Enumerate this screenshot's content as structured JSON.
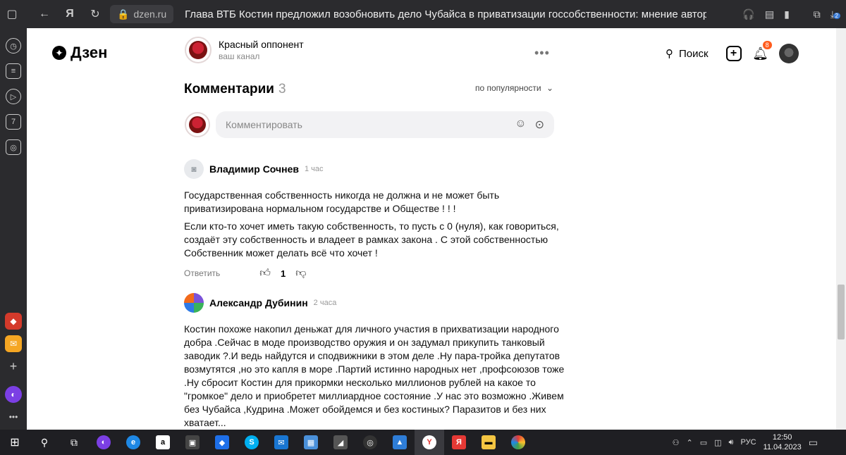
{
  "browser": {
    "url": "dzen.ru",
    "tab_title": "Глава ВТБ Костин предложил возобновить дело Чубайса в приватизации госсобственности: мнение автора | К...",
    "ya_label": "Я",
    "downloads_badge": "2"
  },
  "sidebar": {
    "calendar_label": "7"
  },
  "header": {
    "logo_text": "Дзен",
    "channel_name": "Красный оппонент",
    "channel_sub": "ваш канал",
    "more_label": "•••",
    "search_label": "Поиск",
    "notifications_count": "8"
  },
  "comments": {
    "title": "Комментарии",
    "count": "3",
    "sort_label": "по популярности",
    "compose_placeholder": "Комментировать",
    "items": [
      {
        "author": "Владимир Сочнев",
        "time": "1 час",
        "paragraphs": [
          "Государственная собственность никогда не должна и не может быть приватизирована нормальном государстве и Обществе ! ! !",
          "Если кто-то хочет иметь такую собственность, то пусть с 0 (нуля), как говориться, создаёт эту собственность и владеет в рамках закона . С этой собственностью Собственник может делать всё что хочет !"
        ],
        "reply_label": "Ответить",
        "likes": "1"
      },
      {
        "author": "Александр Дубинин",
        "time": "2 часа",
        "paragraphs": [
          "Костин похоже накопил деньжат для личного участия в прихватизации народного добра .Сейчас в моде производство оружия и он задумал прикупить танковый заводик ?.И ведь найдутся и сподвижники в этом деле .Ну пара-тройка депутатов возмутятся ,но это капля в море .Партий истинно народных нет ,профсоюзов тоже .Ну сбросит Костин для прикормки несколько миллионов рублей на какое то \"громкое\" дело и приобретет миллиардное состояние .У нас это возможно .Живем без Чубайса ,Кудрина .Может обойдемся и без костиных? Паразитов и без них хватает..."
        ]
      }
    ]
  },
  "taskbar": {
    "language": "РУС",
    "time": "12:50",
    "date": "11.04.2023"
  },
  "colors": {
    "accent_orange": "#ff5c1d",
    "browser_dark": "#2b2b2e",
    "input_bg": "#f2f2f4"
  }
}
